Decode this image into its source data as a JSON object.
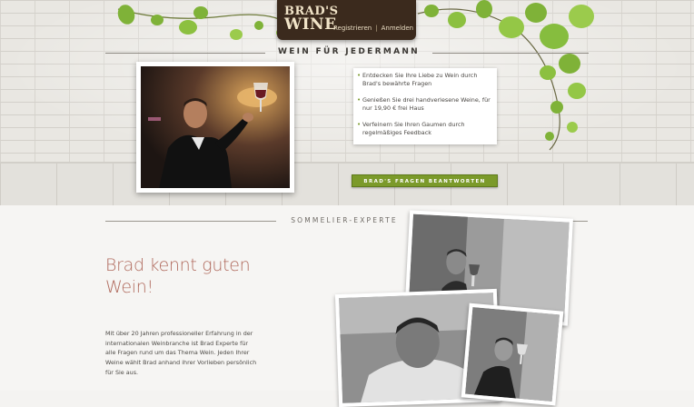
{
  "header": {
    "logo_line1": "BRAD'S",
    "logo_line2": "WINE",
    "nav_register": "Registrieren",
    "nav_login": "Anmelden",
    "nav_separator": "|",
    "tagline": "WEIN FÜR JEDERMANN"
  },
  "hero": {
    "benefits": [
      "Entdecken Sie Ihre Liebe zu Wein durch Brad's bewährte Fragen",
      "Genießen Sie drei handverlesene Weine, für nur 19,90 € frei Haus",
      "Verfeinern Sie Ihren Gaumen durch regelmäßiges Feedback"
    ],
    "cta_label": "BRAD'S FRAGEN BEANTWORTEN"
  },
  "expert": {
    "section_title": "SOMMELIER-EXPERTE",
    "headline": "Brad kennt guten Wein!",
    "body": "Mit über 20 Jahren professioneller Erfahrung in der internationalen Weinbranche ist Brad Experte für alle Fragen rund um das Thema Wein. Jeden Ihrer Weine wählt Brad anhand ihrer Vorlieben persönlich für Sie aus."
  },
  "colors": {
    "accent_green": "#7b9a2a",
    "headline_rose": "#b06a5d",
    "logo_wood": "#3b2a1d"
  },
  "icons": [
    "grape-vine-leaves"
  ]
}
